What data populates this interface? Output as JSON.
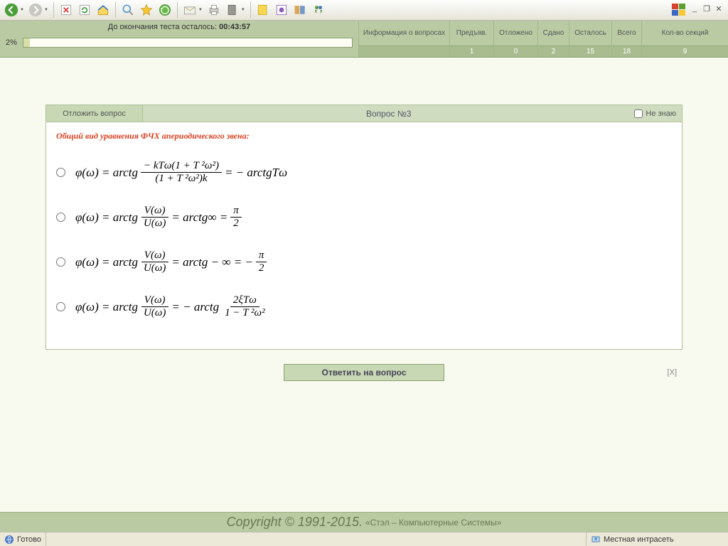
{
  "toolbar": {
    "icons": [
      "back",
      "forward",
      "stop",
      "refresh",
      "home",
      "search",
      "favorites",
      "history",
      "mail",
      "print",
      "edit",
      "discuss",
      "folder",
      "notes",
      "research",
      "messenger"
    ]
  },
  "wincontrols": {
    "min": "_",
    "restore": "❐",
    "close": "✕"
  },
  "header": {
    "timer_label": "До окончания теста осталось: ",
    "timer_value": "00:43:57",
    "progress_pct": "2%",
    "columns": [
      {
        "label": "Информация о вопросах",
        "val": ""
      },
      {
        "label": "Предъяв.",
        "val": "1"
      },
      {
        "label": "Отложено",
        "val": "0"
      },
      {
        "label": "Сдано",
        "val": "2"
      },
      {
        "label": "Осталось",
        "val": "15"
      },
      {
        "label": "Всего",
        "val": "18"
      },
      {
        "label": "Кол-во секций",
        "val": "9"
      }
    ]
  },
  "question": {
    "postpone": "Отложить вопрос",
    "number": "Вопрос №3",
    "dontknow": "Не знаю",
    "text": "Общий вид уравнения ФЧХ апериодического звена:",
    "options": {
      "a": {
        "lhs": "φ(ω) = arctg",
        "num": "− kTω(1 + T ²ω²)",
        "den": "(1 + T ²ω²)k",
        "rhs": " = − arctgTω"
      },
      "b": {
        "lhs": "φ(ω) = arctg",
        "num": "V(ω)",
        "den": "U(ω)",
        "mid": " = arctg∞ = ",
        "num2": "π",
        "den2": "2"
      },
      "c": {
        "lhs": "φ(ω) = arctg",
        "num": "V(ω)",
        "den": "U(ω)",
        "mid": " = arctg − ∞ = − ",
        "num2": "π",
        "den2": "2"
      },
      "d": {
        "lhs": "φ(ω) = arctg",
        "num": "V(ω)",
        "den": "U(ω)",
        "mid": " = − arctg",
        "num2": "2ξTω",
        "den2": "1 − T ²ω²"
      }
    }
  },
  "actions": {
    "answer": "Ответить на вопрос",
    "x": "[X]"
  },
  "footer": {
    "copyright": "Copyright © 1991-2015.",
    "company": " «Стэл – Компьютерные Системы»"
  },
  "status": {
    "ready": "Готово",
    "zone": "Местная интрасеть"
  }
}
